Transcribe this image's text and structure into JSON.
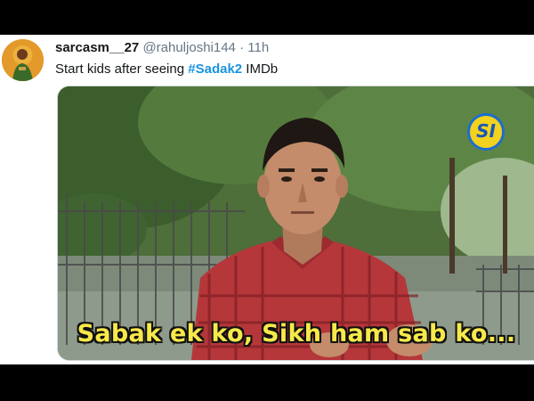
{
  "tweet": {
    "display_name": "sarcasm__27",
    "handle": "@rahuljoshi144",
    "separator": "·",
    "time": "11h",
    "text_prefix": "Start kids after seeing ",
    "hashtag": "#Sadak2",
    "text_suffix": " IMDb"
  },
  "media": {
    "caption": "Sabak ek ko, Sikh ham sab ko...",
    "channel_logo": "SI"
  },
  "colors": {
    "hashtag": "#1b95e0",
    "caption": "#f8e94a",
    "secondary_text": "#657786"
  },
  "icons": {
    "avatar": "user-avatar-icon",
    "channel_logo": "channel-logo-icon"
  }
}
